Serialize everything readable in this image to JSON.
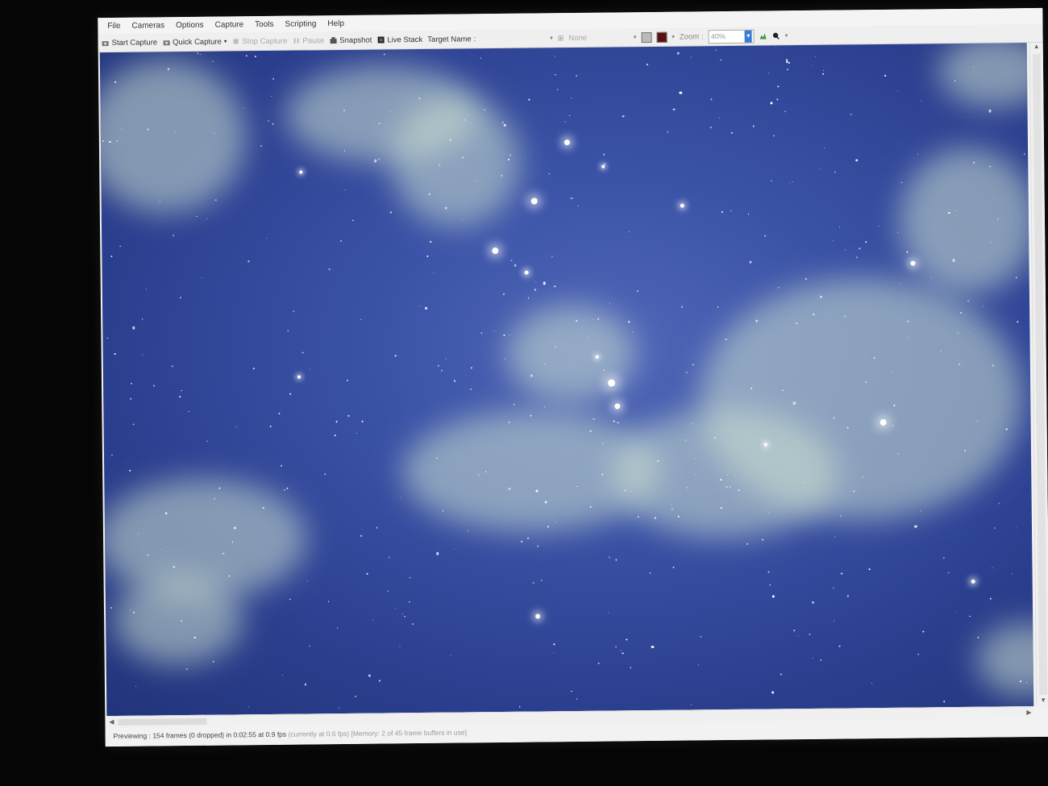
{
  "menu": [
    "File",
    "Cameras",
    "Options",
    "Capture",
    "Tools",
    "Scripting",
    "Help"
  ],
  "toolbar": {
    "start_capture": "Start Capture",
    "quick_capture": "Quick Capture",
    "stop_capture": "Stop Capture",
    "pause": "Pause",
    "snapshot": "Snapshot",
    "live_stack": "Live Stack",
    "target_name": "Target Name",
    "filter_value": "None",
    "zoom_label": "Zoom",
    "zoom_value": "40%"
  },
  "status": {
    "main": "Previewing : 154 frames (0 dropped) in 0:02:55 at 0.9 fps",
    "extra": "(currently at 0.6 fps) [Memory: 2 of 45 frame buffers in use]"
  },
  "colors": {
    "sky": "#2b3f8f",
    "cloud": "#cde1d2",
    "star": "#ffffff"
  }
}
